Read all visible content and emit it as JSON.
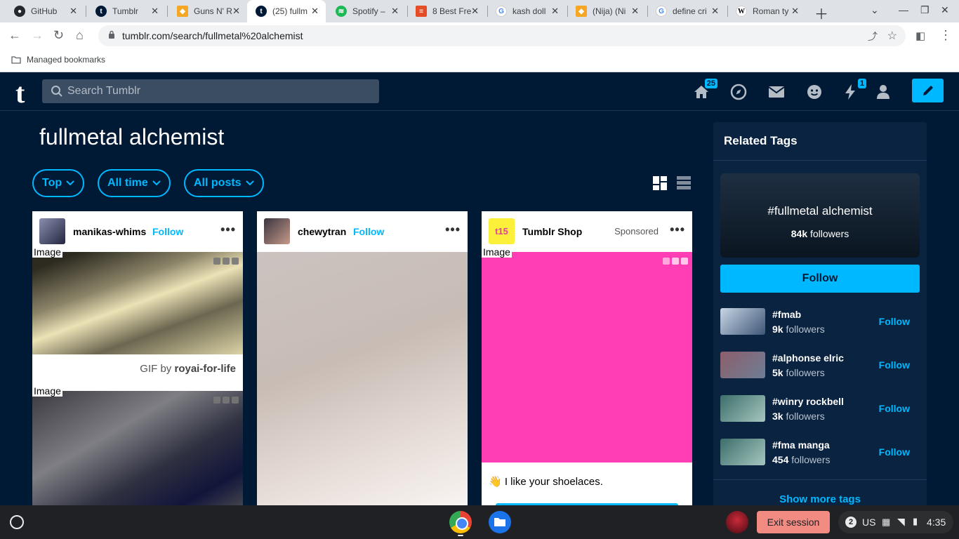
{
  "browser": {
    "tabs": [
      {
        "label": "GitHub",
        "icon": "github-icon",
        "color": "#24292f"
      },
      {
        "label": "Tumblr",
        "icon": "tumblr-icon",
        "color": "#001935"
      },
      {
        "label": "Guns N' R",
        "icon": "guns-icon",
        "color": "#f5a623"
      },
      {
        "label": "(25) fullm",
        "icon": "tumblr-icon",
        "color": "#001935",
        "active": true
      },
      {
        "label": "Spotify –",
        "icon": "spotify-icon",
        "color": "#1db954"
      },
      {
        "label": "8 Best Fre",
        "icon": "article-icon",
        "color": "#e44d26"
      },
      {
        "label": "kash doll",
        "icon": "google-icon",
        "color": "#4285f4"
      },
      {
        "label": "(Nija) (Ni",
        "icon": "guns-icon",
        "color": "#f5a623"
      },
      {
        "label": "define cri",
        "icon": "google-icon",
        "color": "#4285f4"
      },
      {
        "label": "Roman ty",
        "icon": "wikipedia-icon",
        "color": "#000000"
      }
    ],
    "url": "tumblr.com/search/fullmetal%20alchemist",
    "bookmarks_label": "Managed bookmarks"
  },
  "tumblr": {
    "logo": "t",
    "search_placeholder": "Search Tumblr",
    "badges": {
      "home": "25",
      "activity": "1"
    },
    "query_title": "fullmetal alchemist",
    "filters": [
      "Top",
      "All time",
      "All posts"
    ],
    "accent": "#00b8ff"
  },
  "posts": [
    {
      "author": "manikas-whims",
      "follow": "Follow",
      "image_alt": "Image",
      "image2_alt": "Image",
      "credit_prefix": "GIF by",
      "credit_author": "royai-for-life"
    },
    {
      "author": "chewytran",
      "follow": "Follow"
    },
    {
      "author": "Tumblr Shop",
      "avatar_text": "t15",
      "sponsored": "Sponsored",
      "image_alt": "Image",
      "text": "👋 I like your shoelaces."
    }
  ],
  "sidebar": {
    "title": "Related Tags",
    "main_tag": {
      "name": "#fullmetal alchemist",
      "followers": "84k",
      "followers_label": "followers"
    },
    "follow_label": "Follow",
    "tags": [
      {
        "name": "#fmab",
        "followers": "9k",
        "label": "followers",
        "follow": "Follow"
      },
      {
        "name": "#alphonse elric",
        "followers": "5k",
        "label": "followers",
        "follow": "Follow"
      },
      {
        "name": "#winry rockbell",
        "followers": "3k",
        "label": "followers",
        "follow": "Follow"
      },
      {
        "name": "#fma manga",
        "followers": "454",
        "label": "followers",
        "follow": "Follow"
      }
    ],
    "show_more": "Show more tags"
  },
  "shelf": {
    "exit_session": "Exit session",
    "notifications": "2",
    "keyboard": "US",
    "time": "4:35"
  }
}
